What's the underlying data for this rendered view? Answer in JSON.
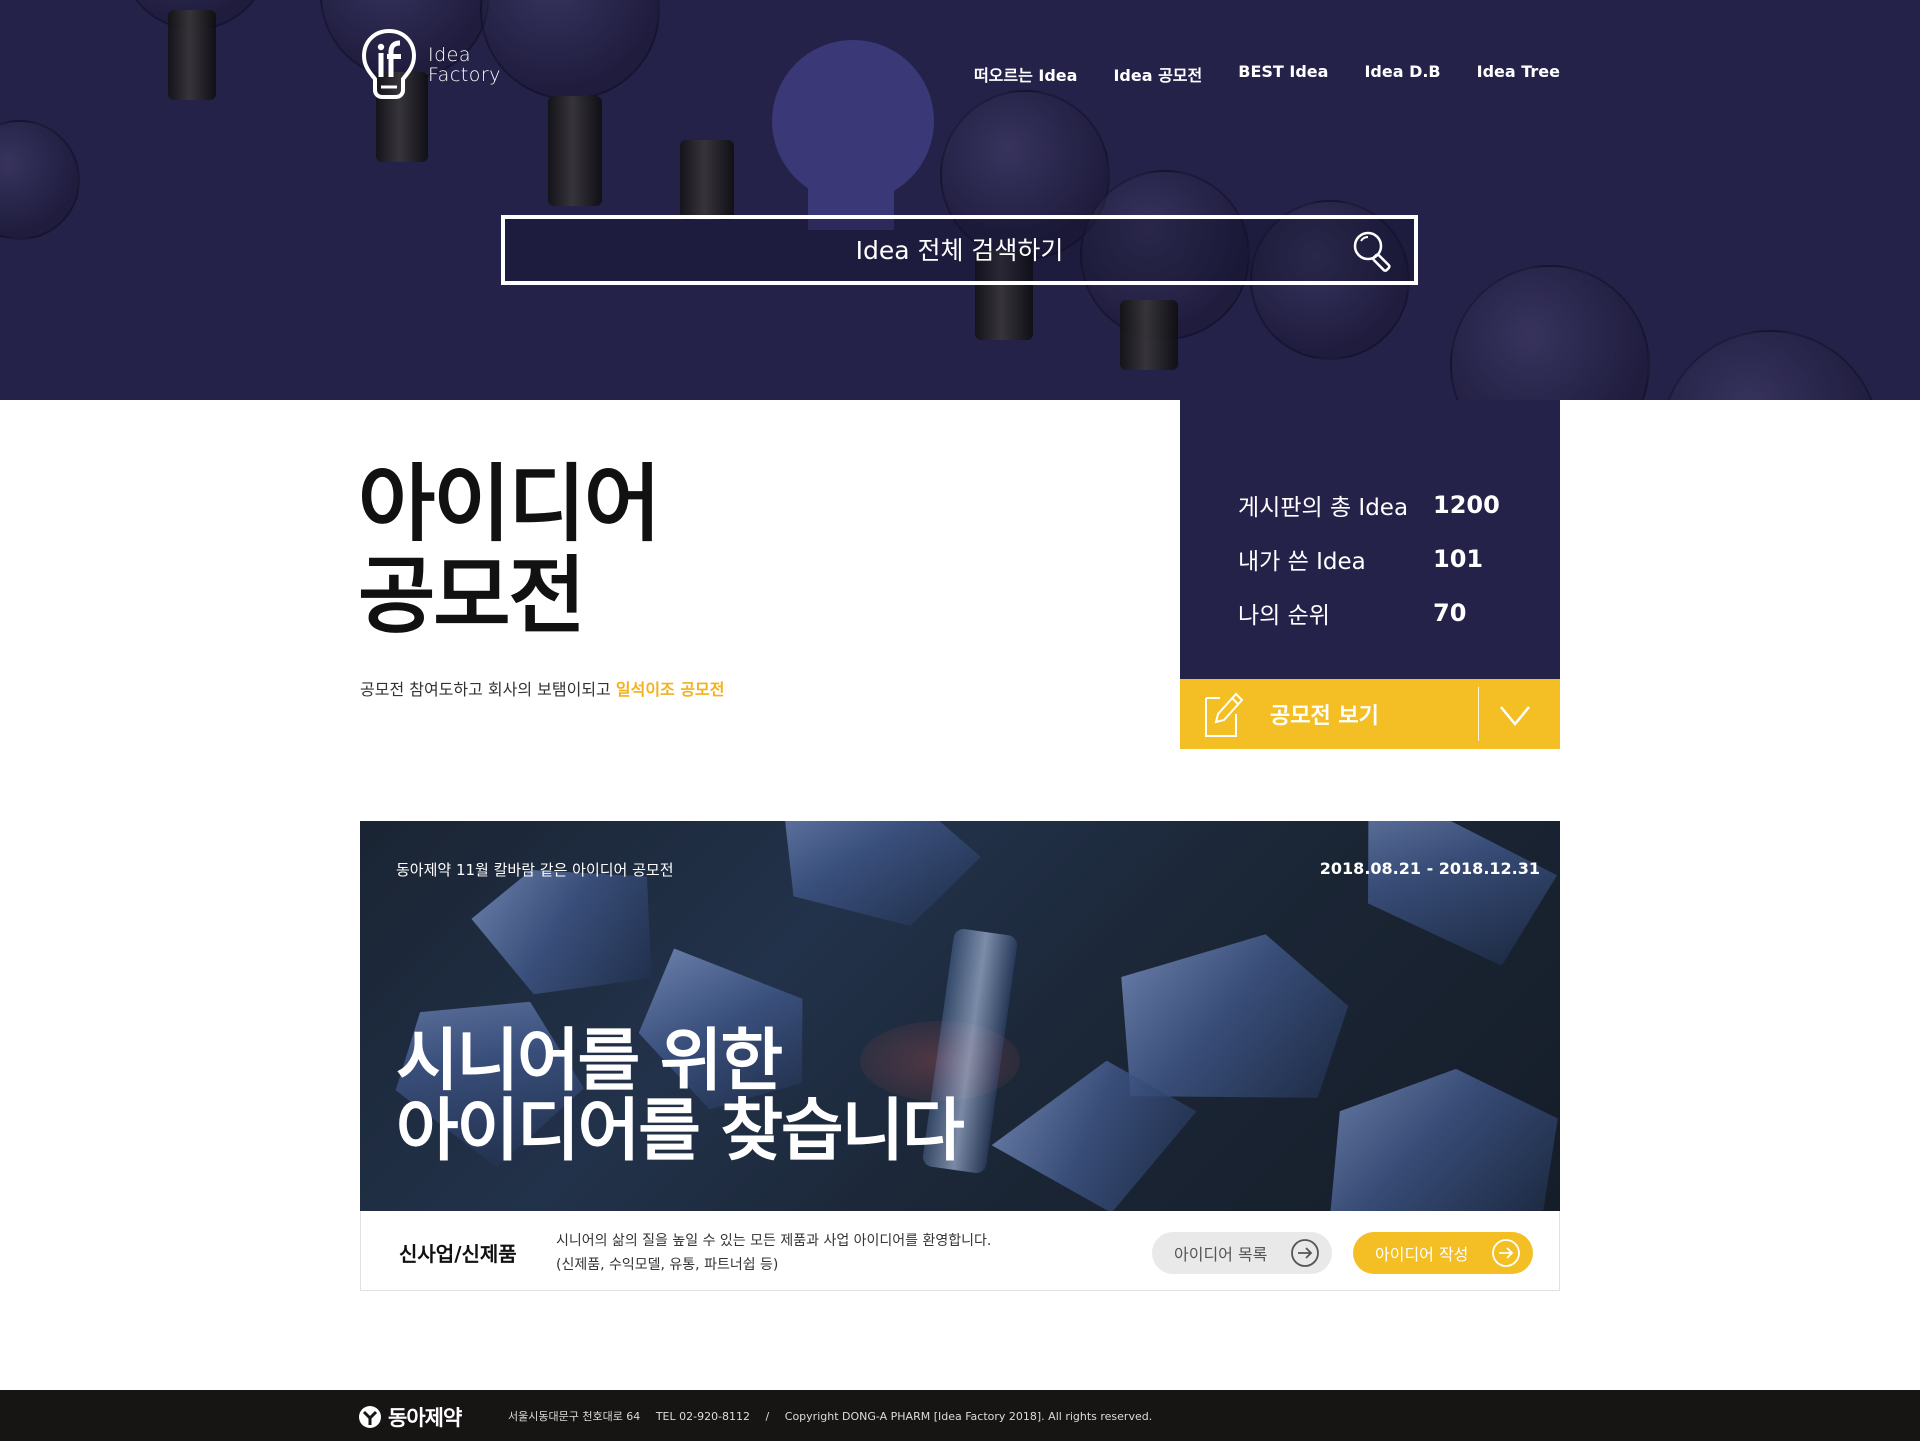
{
  "header": {
    "logo_text_line1": "Idea",
    "logo_text_line2": "Factory",
    "nav": [
      "떠오르는 Idea",
      "Idea 공모전",
      "BEST Idea",
      "Idea D.B",
      "Idea Tree"
    ],
    "search_placeholder": "Idea 전체 검색하기"
  },
  "intro": {
    "title_line1": "아이디어",
    "title_line2": "공모전",
    "subtitle_prefix": "공모전 참여도하고 회사의 보탬이되고 ",
    "subtitle_highlight": "일석이조 공모전"
  },
  "stats": [
    {
      "label": "게시판의 총 Idea",
      "value": "1200"
    },
    {
      "label": "내가 쓴 Idea",
      "value": "101"
    },
    {
      "label": "나의 순위",
      "value": "70"
    }
  ],
  "contest_button": {
    "label": "공모전 보기"
  },
  "contest_card": {
    "kicker": "동아제약 11월 칼바람 같은 아이디어 공모전",
    "date_range": "2018.08.21 - 2018.12.31",
    "headline_line1": "시니어를 위한",
    "headline_line2": "아이디어를 찾습니다",
    "category": "신사업/신제품",
    "description_line1": "시니어의 삶의 질을 높일 수 있는 모든 제품과 사업 아이디어를 환영합니다.",
    "description_line2": "(신제품, 수익모델, 유통, 파트너쉽 등)",
    "list_button": "아이디어 목록",
    "write_button": "아이디어 작성"
  },
  "footer": {
    "brand": "동아제약",
    "address": "서울시동대문구 천호대로 64",
    "tel": "TEL 02-920-8112",
    "separator": "/",
    "copyright": "Copyright DONG-A PHARM [Idea Factory 2018]. All rights reserved."
  },
  "colors": {
    "navy": "#25224a",
    "accent_yellow": "#f4bf25",
    "footer_bg": "#171414"
  },
  "icons": [
    "logo-bulb-icon",
    "search-icon",
    "pencil-icon",
    "chevron-down-icon",
    "arrow-right-icon",
    "donga-logo-icon"
  ]
}
